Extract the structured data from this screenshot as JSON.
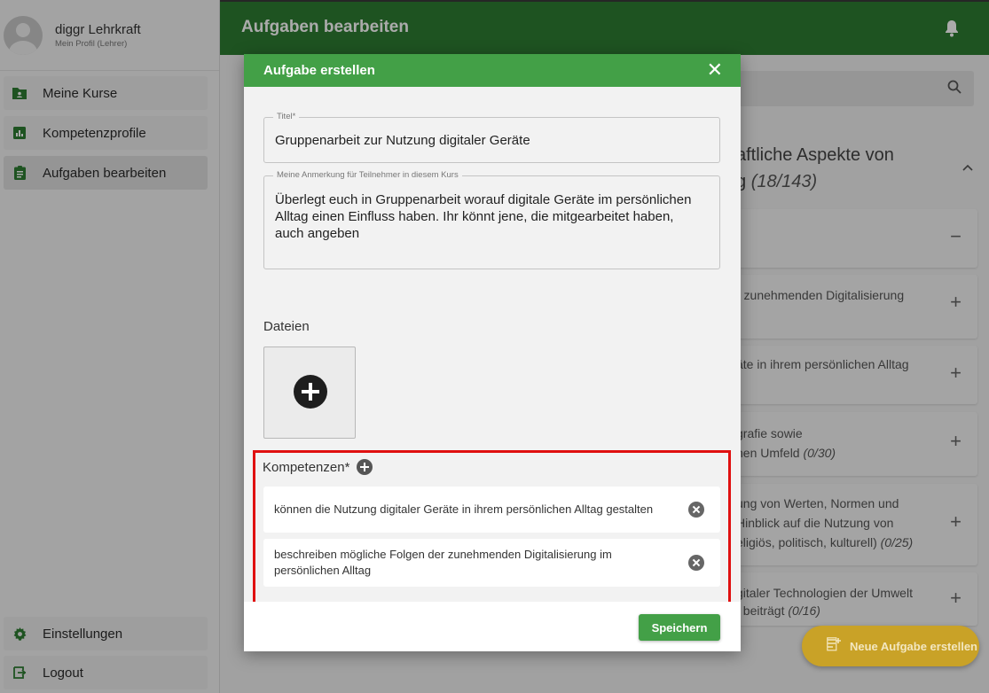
{
  "profile": {
    "name": "diggr Lehrkraft",
    "subtitle": "Mein Profil (Lehrer)"
  },
  "sidebar": {
    "items": [
      {
        "label": "Meine Kurse",
        "icon": "folder-person-icon"
      },
      {
        "label": "Kompetenzprofile",
        "icon": "bar-chart-icon"
      },
      {
        "label": "Aufgaben bearbeiten",
        "icon": "clipboard-icon",
        "active": true
      }
    ],
    "bottom": [
      {
        "label": "Einstellungen",
        "icon": "gear-icon"
      },
      {
        "label": "Logout",
        "icon": "logout-icon"
      }
    ]
  },
  "header": {
    "title": "Aufgaben bearbeiten"
  },
  "background": {
    "heading_line1": "aftliche Aspekte von",
    "heading_line2": "g ",
    "heading_count": "(18/143)",
    "cards": [
      {
        "line1": "r zunehmenden Digitalisierung",
        "line2": "",
        "symbol": "+"
      },
      {
        "line1": "äte in ihrem persönlichen Alltag",
        "line2": "",
        "symbol": "+"
      },
      {
        "line1": "grafie sowie",
        "line2": "hen Umfeld ",
        "count": "(0/30)",
        "symbol": "+"
      },
      {
        "line1": "ung von Werten, Normen und",
        "line2": "Hinblick auf die Nutzung von",
        "line3": "eligiös, politisch, kulturell) ",
        "count": "(0/25)",
        "symbol": "+"
      },
      {
        "line1": "gitaler Technologien der Umwelt",
        "line2": "t beiträgt ",
        "count": "(0/16)",
        "symbol": "+"
      }
    ],
    "expanded_symbol": "−"
  },
  "fab": {
    "label": "Neue Aufgabe erstellen"
  },
  "dialog": {
    "title": "Aufgabe erstellen",
    "close": "✕",
    "title_field": {
      "label": "Titel*",
      "value": "Gruppenarbeit zur Nutzung digitaler Geräte"
    },
    "note_field": {
      "label": "Meine Anmerkung für Teilnehmer in diesem Kurs",
      "value": "Überlegt euch in Gruppenarbeit worauf digitale Geräte im persönlichen Alltag einen Einfluss haben. Ihr könnt jene, die mitgearbeitet haben, auch angeben"
    },
    "files_label": "Dateien",
    "competencies_label": "Kompetenzen*",
    "competencies": [
      "können die Nutzung digitaler Geräte in ihrem persönlichen Alltag gestalten",
      "beschreiben mögliche Folgen der zunehmenden Digitalisierung im persönlichen Alltag"
    ],
    "save_label": "Speichern"
  },
  "colors": {
    "primary": "#2e7d32",
    "accent": "#43a047",
    "highlight": "#e01010",
    "fab": "#c9a227"
  }
}
